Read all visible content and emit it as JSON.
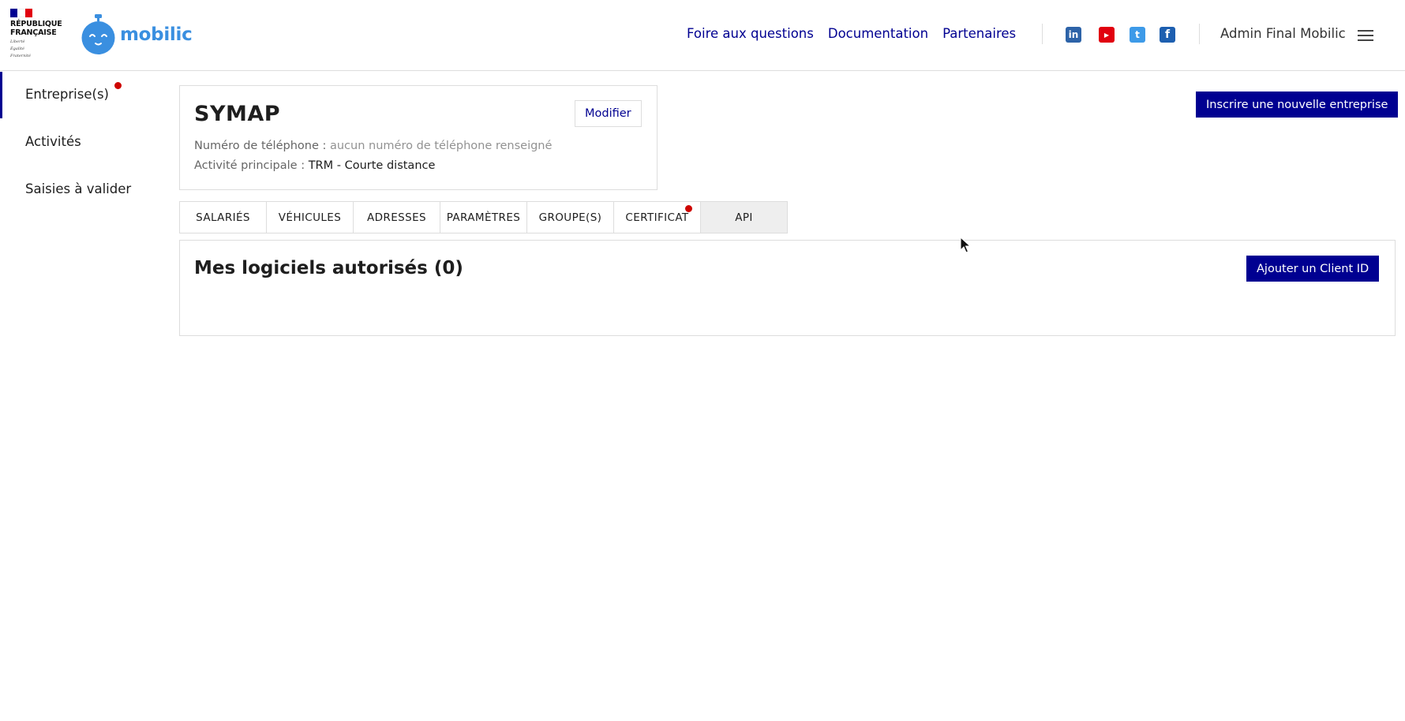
{
  "header": {
    "gov_logo": {
      "lines": [
        "RÉPUBLIQUE",
        "FRANÇAISE"
      ],
      "motto": [
        "Liberté",
        "Égalité",
        "Fraternité"
      ],
      "flag_colors": [
        "#000091",
        "#ffffff",
        "#e1000f"
      ]
    },
    "brand": {
      "name": "mobilic",
      "color": "#3a8fe0",
      "icon": "stopwatch-face-icon"
    },
    "nav_links": [
      "Foire aux questions",
      "Documentation",
      "Partenaires"
    ],
    "social": [
      {
        "name": "linkedin-icon",
        "glyph": "in",
        "color": "#2d63a8"
      },
      {
        "name": "youtube-icon",
        "glyph": "▶",
        "color": "#e1000f"
      },
      {
        "name": "twitter-icon",
        "glyph": "t",
        "color": "#3d9ae8"
      },
      {
        "name": "facebook-icon",
        "glyph": "f",
        "color": "#1d5fb0"
      }
    ],
    "user_name": "Admin Final Mobilic",
    "menu_icon": "hamburger-menu-icon"
  },
  "sidebar": {
    "items": [
      {
        "label": "Entreprise(s)",
        "active": true,
        "notification": true
      },
      {
        "label": "Activités",
        "active": false,
        "notification": false
      },
      {
        "label": "Saisies à valider",
        "active": false,
        "notification": false
      }
    ]
  },
  "company": {
    "name": "SYMAP",
    "edit_label": "Modifier",
    "phone_label": "Numéro de téléphone : ",
    "phone_value": "aucun numéro de téléphone renseigné",
    "activity_label": "Activité principale : ",
    "activity_value": "TRM - Courte distance"
  },
  "register_button": "Inscrire une nouvelle entreprise",
  "tabs": [
    {
      "label": "SALARIÉS",
      "active": false,
      "notification": false
    },
    {
      "label": "VÉHICULES",
      "active": false,
      "notification": false
    },
    {
      "label": "ADRESSES",
      "active": false,
      "notification": false
    },
    {
      "label": "PARAMÈTRES",
      "active": false,
      "notification": false
    },
    {
      "label": "GROUPE(S)",
      "active": false,
      "notification": false
    },
    {
      "label": "CERTIFICAT",
      "active": false,
      "notification": true
    },
    {
      "label": "API",
      "active": true,
      "notification": false
    }
  ],
  "api_panel": {
    "title": "Mes logiciels autorisés (0)",
    "add_button": "Ajouter un Client ID"
  },
  "colors": {
    "primary": "#000091",
    "notification": "#ce0500",
    "border": "#dddddd"
  }
}
